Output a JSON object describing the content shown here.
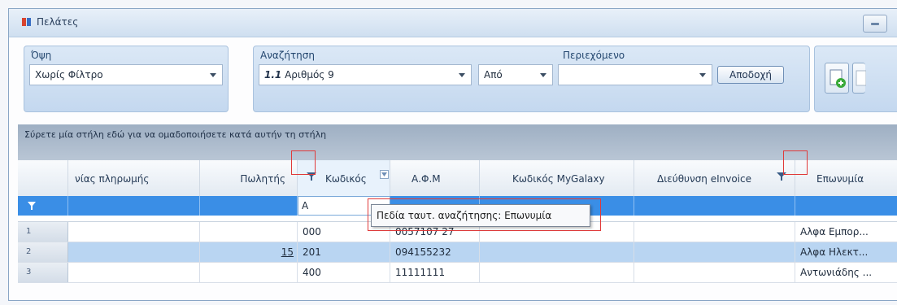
{
  "window": {
    "title": "Πελάτες"
  },
  "toolbar": {
    "view_label": "Όψη",
    "view_value": "Χωρίς Φίλτρο",
    "search_label": "Αναζήτηση",
    "search_prefix": "1.1",
    "search_value": "Αριθμός 9",
    "operator_value": "Από",
    "content_label": "Περιεχόμενο",
    "content_value": "",
    "accept_label": "Αποδοχή"
  },
  "group_bar": {
    "hint": "Σύρετε μία στήλη εδώ για να ομαδοποιήσετε κατά αυτήν τη στήλη"
  },
  "columns": [
    "νίας πληρωμής",
    "Πωλητής",
    "Κωδικός",
    "Α.Φ.Μ",
    "Κωδικός MyGalaxy",
    "Διεύθυνση eInvoice",
    "Επωνυμία"
  ],
  "filter": {
    "code_value": "A"
  },
  "tooltip": {
    "text": "Πεδία ταυτ. αναζήτησης: Επωνυμία"
  },
  "rows": [
    {
      "num": "1",
      "salesman": "",
      "code": "000",
      "afm": "0057107 27",
      "name": "Αλφα Εμπορ..."
    },
    {
      "num": "2",
      "salesman": "15",
      "code": "201",
      "afm": "094155232",
      "name": "Αλφα Ηλεκτ..."
    },
    {
      "num": "3",
      "salesman": "",
      "code": "400",
      "afm": "11111111",
      "name": "Αντωνιάδης ..."
    }
  ],
  "colors": {
    "selected_row": "#b9d5f2",
    "filter_row": "#3a8ee6",
    "highlight_box": "#e03a3a"
  }
}
